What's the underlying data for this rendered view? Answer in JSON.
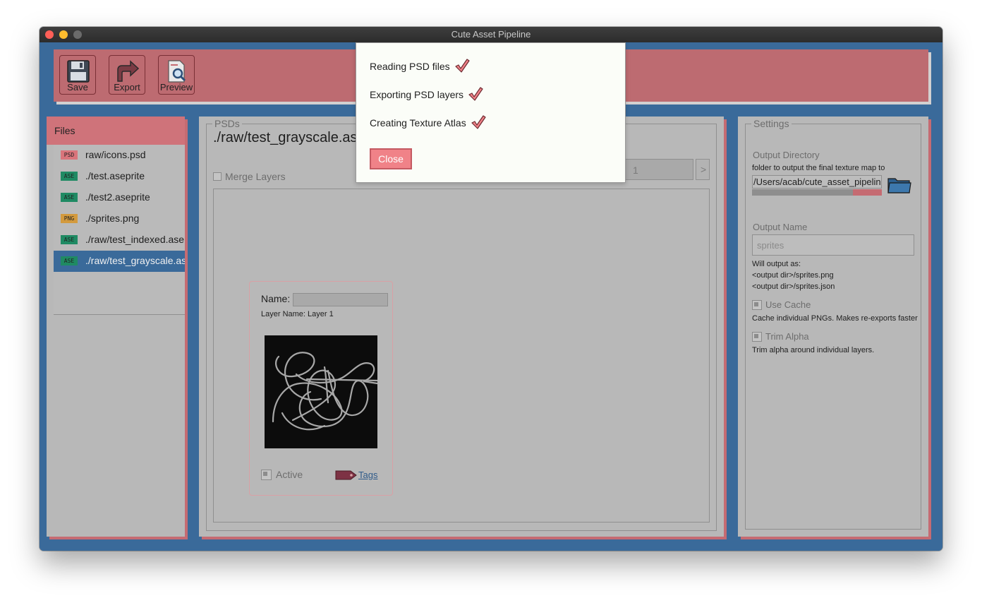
{
  "window": {
    "title": "Cute Asset Pipeline"
  },
  "colors": {
    "accent": "#bd6b71",
    "background": "#3a6a9a",
    "panel": "#b8b8b8",
    "dialog_bg": "#fbfdf8",
    "close_button": "#f08288"
  },
  "toolbar": {
    "buttons": [
      {
        "label": "Save",
        "icon": "floppy-disk-icon"
      },
      {
        "label": "Export",
        "icon": "export-arrow-icon"
      },
      {
        "label": "Preview",
        "icon": "preview-magnifier-icon"
      }
    ]
  },
  "files": {
    "header": "Files",
    "items": [
      {
        "badge": "PSD",
        "badge_color": "#d9747b",
        "name": "raw/icons.psd",
        "selected": false
      },
      {
        "badge": "ASE",
        "badge_color": "#1f8a63",
        "name": "./test.aseprite",
        "selected": false
      },
      {
        "badge": "ASE",
        "badge_color": "#1f8a63",
        "name": "./test2.aseprite",
        "selected": false
      },
      {
        "badge": "PNG",
        "badge_color": "#d39a3e",
        "name": "./sprites.png",
        "selected": false
      },
      {
        "badge": "ASE",
        "badge_color": "#1f8a63",
        "name": "./raw/test_indexed.aseprite",
        "selected": false
      },
      {
        "badge": "ASE",
        "badge_color": "#1f8a63",
        "name": "./raw/test_grayscale.aseprite",
        "selected": true
      }
    ]
  },
  "psds": {
    "legend": "PSDs",
    "current_file": "./raw/test_grayscale.aseprite",
    "merge_layers_label": "Merge Layers",
    "frame_value": "1",
    "next_label": ">",
    "card": {
      "name_label": "Name:",
      "name_value": "",
      "layer_name": "Layer Name: Layer 1",
      "active_label": "Active",
      "tags_label": "Tags"
    }
  },
  "settings": {
    "legend": "Settings",
    "output_dir_title": "Output Directory",
    "output_dir_desc": "folder to output the final texture map to",
    "output_dir_value": "/Users/acab/cute_asset_pipeline",
    "output_name_title": "Output Name",
    "output_name_value": "sprites",
    "will_output_as": "Will output as:",
    "output_png": "<output dir>/sprites.png",
    "output_json": "<output dir>/sprites.json",
    "use_cache_label": "Use Cache",
    "use_cache_desc": "Cache individual PNGs. Makes re-exports faster",
    "trim_alpha_label": "Trim Alpha",
    "trim_alpha_desc": "Trim alpha around individual layers."
  },
  "dialog": {
    "steps": [
      {
        "label": "Reading PSD files",
        "done": true
      },
      {
        "label": "Exporting PSD layers",
        "done": true
      },
      {
        "label": "Creating Texture Atlas",
        "done": true
      }
    ],
    "close_label": "Close"
  }
}
